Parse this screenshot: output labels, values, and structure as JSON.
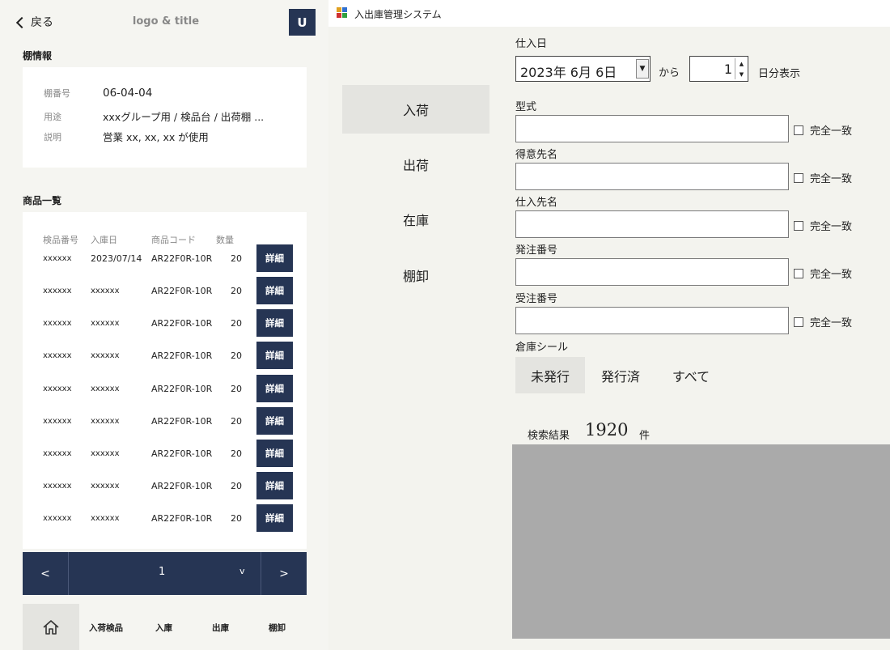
{
  "mobile": {
    "header": {
      "back_label": "戻る",
      "title": "logo & title",
      "avatar": "U"
    },
    "shelf": {
      "section_title": "棚情報",
      "rows": [
        {
          "label": "棚番号",
          "value": "06-04-04"
        },
        {
          "label": "用途",
          "value": "xxxグループ用 / 検品台 / 出荷棚 ..."
        },
        {
          "label": "説明",
          "value": "営業 xx, xx, xx が使用"
        }
      ]
    },
    "products": {
      "section_title": "商品一覧",
      "columns": [
        "検品番号",
        "入庫日",
        "商品コード",
        "数量"
      ],
      "detail_label": "詳細",
      "rows": [
        {
          "no": "xxxxxx",
          "date": "2023/07/14",
          "code": "AR22F0R-10R",
          "qty": "20"
        },
        {
          "no": "xxxxxx",
          "date": "xxxxxx",
          "code": "AR22F0R-10R",
          "qty": "20"
        },
        {
          "no": "xxxxxx",
          "date": "xxxxxx",
          "code": "AR22F0R-10R",
          "qty": "20"
        },
        {
          "no": "xxxxxx",
          "date": "xxxxxx",
          "code": "AR22F0R-10R",
          "qty": "20"
        },
        {
          "no": "xxxxxx",
          "date": "xxxxxx",
          "code": "AR22F0R-10R",
          "qty": "20"
        },
        {
          "no": "xxxxxx",
          "date": "xxxxxx",
          "code": "AR22F0R-10R",
          "qty": "20"
        },
        {
          "no": "xxxxxx",
          "date": "xxxxxx",
          "code": "AR22F0R-10R",
          "qty": "20"
        },
        {
          "no": "xxxxxx",
          "date": "xxxxxx",
          "code": "AR22F0R-10R",
          "qty": "20"
        },
        {
          "no": "xxxxxx",
          "date": "xxxxxx",
          "code": "AR22F0R-10R",
          "qty": "20"
        }
      ]
    },
    "pager": {
      "prev": "<",
      "page": "1",
      "dropdown": "v",
      "next": ">"
    },
    "tabbar": {
      "home_icon": "home-icon",
      "items": [
        "入荷検品",
        "入庫",
        "出庫",
        "棚卸"
      ]
    },
    "colors": {
      "primary": "#263554",
      "background": "#f5f5f1",
      "card": "#ffffff"
    }
  },
  "desktop": {
    "window_title": "入出庫管理システム",
    "nav": [
      {
        "label": "入荷",
        "active": true
      },
      {
        "label": "出荷",
        "active": false
      },
      {
        "label": "在庫",
        "active": false
      },
      {
        "label": "棚卸",
        "active": false
      }
    ],
    "date_filter": {
      "label": "仕入日",
      "date_value": "2023年  6月  6日",
      "from_label": "から",
      "days_value": "1",
      "days_label": "日分表示"
    },
    "fields": [
      {
        "label": "型式",
        "value": "",
        "exact_label": "完全一致"
      },
      {
        "label": "得意先名",
        "value": "",
        "exact_label": "完全一致"
      },
      {
        "label": "仕入先名",
        "value": "",
        "exact_label": "完全一致"
      },
      {
        "label": "発注番号",
        "value": "",
        "exact_label": "完全一致"
      },
      {
        "label": "受注番号",
        "value": "",
        "exact_label": "完全一致"
      }
    ],
    "seal": {
      "label": "倉庫シール",
      "options": [
        {
          "label": "未発行",
          "active": true
        },
        {
          "label": "発行済",
          "active": false
        },
        {
          "label": "すべて",
          "active": false
        }
      ]
    },
    "result": {
      "label": "検索結果",
      "count": "1920",
      "unit": "件"
    },
    "colors": {
      "background": "#f3f3ee",
      "selected": "#e4e4e0",
      "result_area": "#aaaaaa"
    }
  }
}
